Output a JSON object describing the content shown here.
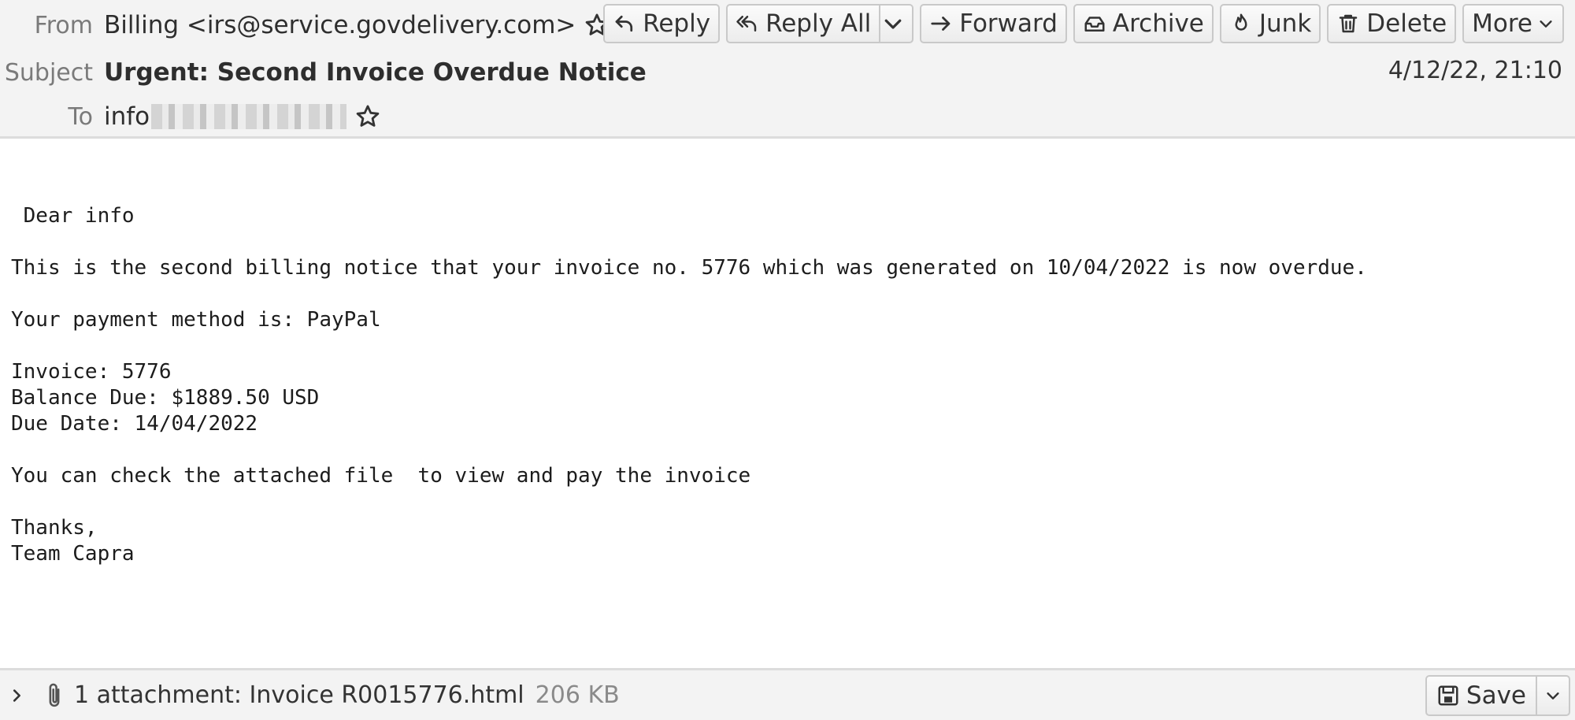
{
  "header": {
    "from_label": "From",
    "from_value": "Billing <irs@service.govdelivery.com>",
    "subject_label": "Subject",
    "subject_value": "Urgent: Second Invoice Overdue Notice",
    "to_label": "To",
    "to_value": "info",
    "date": "4/12/22, 21:10"
  },
  "toolbar": {
    "reply": "Reply",
    "reply_all": "Reply All",
    "forward": "Forward",
    "archive": "Archive",
    "junk": "Junk",
    "delete": "Delete",
    "more": "More"
  },
  "message": {
    "body": " Dear info\n\nThis is the second billing notice that your invoice no. 5776 which was generated on 10/04/2022 is now overdue.\n\nYour payment method is: PayPal\n\nInvoice: 5776\nBalance Due: $1889.50 USD\nDue Date: 14/04/2022\n\nYou can check the attached file  to view and pay the invoice\n\nThanks,\nTeam Capra"
  },
  "attachment": {
    "label": "1 attachment: Invoice R0015776.html",
    "size": "206 KB",
    "save": "Save"
  }
}
